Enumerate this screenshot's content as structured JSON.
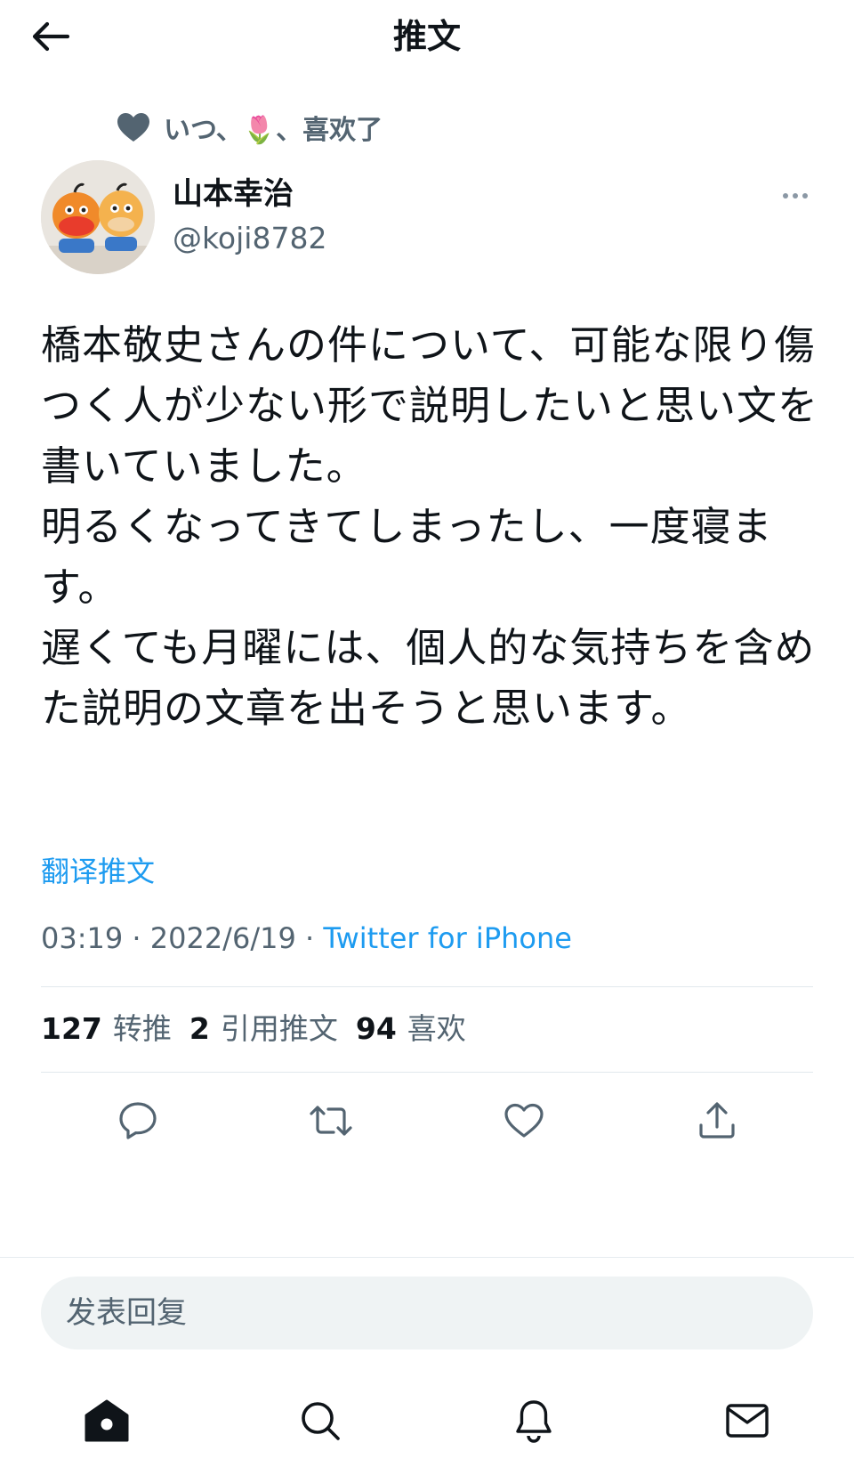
{
  "header": {
    "title": "推文"
  },
  "liked_by": {
    "text": "いつ、🌷、喜欢了"
  },
  "author": {
    "name": "山本幸治",
    "handle": "@koji8782"
  },
  "tweet": {
    "text": "橋本敬史さんの件について、可能な限り傷つく人が少ない形で説明したいと思い文を書いていました。\n明るくなってきてしまったし、一度寝ます。\n遅くても月曜には、個人的な気持ちを含めた説明の文章を出そうと思います。",
    "translate_label": "翻译推文",
    "time": "03:19 · 2022/6/19 · ",
    "source": "Twitter for iPhone"
  },
  "stats": {
    "retweets_count": "127",
    "retweets_label": "转推",
    "quotes_count": "2",
    "quotes_label": "引用推文",
    "likes_count": "94",
    "likes_label": "喜欢"
  },
  "reply": {
    "placeholder": "发表回复"
  },
  "icons": {
    "back": "arrow-left-icon",
    "liked": "heart-filled-icon",
    "more": "more-dots-icon",
    "reply": "comment-icon",
    "retweet": "retweet-icon",
    "like": "heart-outline-icon",
    "share": "share-icon",
    "home": "home-icon",
    "search": "search-icon",
    "notifications": "bell-icon",
    "messages": "mail-icon"
  },
  "colors": {
    "accent": "#1d9bf0",
    "secondary_text": "#536471",
    "text": "#0f1419"
  }
}
